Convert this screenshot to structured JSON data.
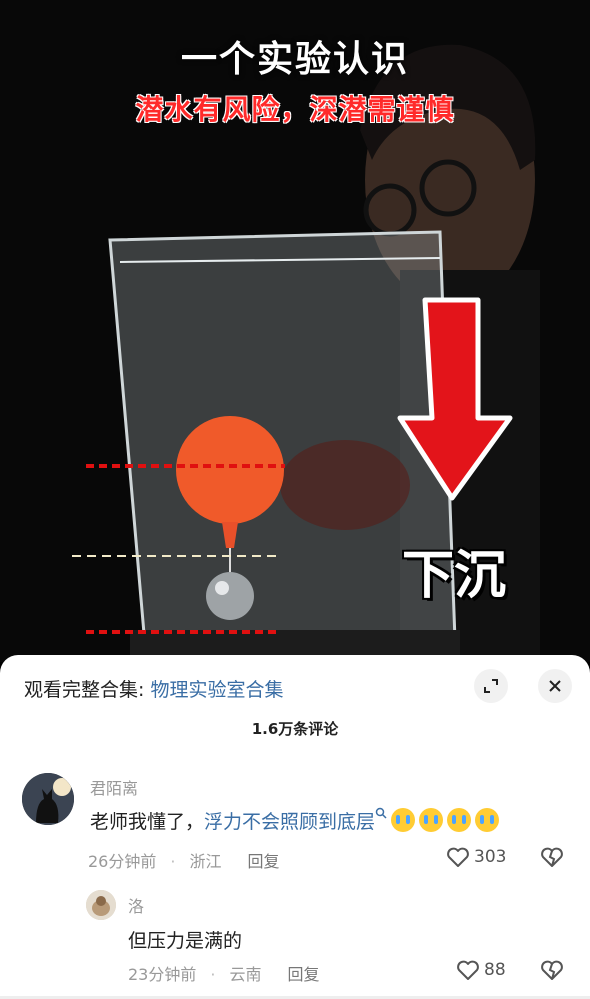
{
  "video": {
    "title": "一个实验认识",
    "subtitle": "潜水有风险，深潜需谨慎",
    "sink_label": "下沉"
  },
  "panel": {
    "collection_prefix": "观看完整合集:",
    "collection_name": "物理实验室合集",
    "comment_count": "1.6万条评论"
  },
  "comments": [
    {
      "user": "君陌离",
      "text_plain": "老师我懂了，",
      "text_link": "浮力不会照顾到底层",
      "time": "26分钟前",
      "location": "浙江",
      "reply_label": "回复",
      "likes": "303"
    },
    {
      "user": "洛",
      "text": "但压力是满的",
      "time": "23分钟前",
      "location": "云南",
      "reply_label": "回复",
      "likes": "88"
    }
  ],
  "icons": {
    "expand": "expand-icon",
    "close": "close-icon",
    "like": "heart-icon",
    "dislike": "broken-heart-icon",
    "search": "search-icon"
  },
  "colors": {
    "link": "#3a6ea5",
    "subtitle_red": "#ff2a2a",
    "arrow_red": "#e3141a"
  }
}
